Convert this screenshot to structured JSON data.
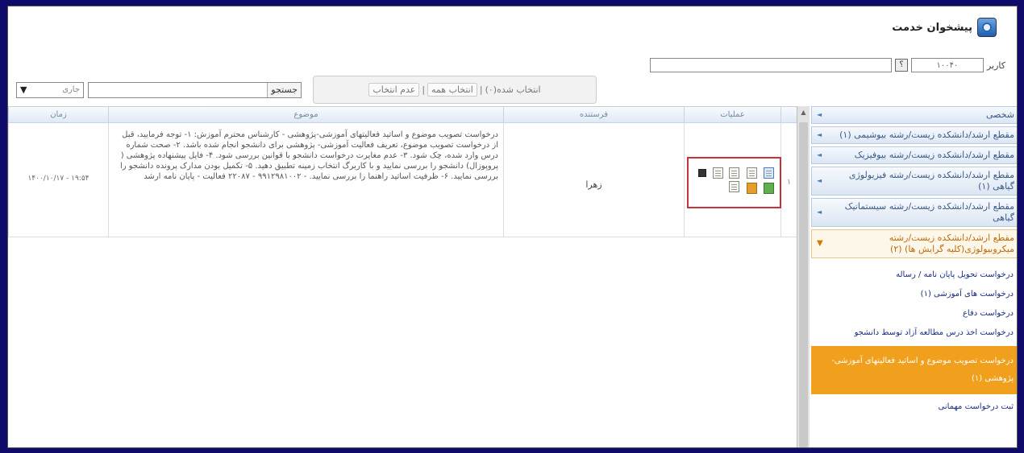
{
  "header": {
    "title": "پیشخوان خدمت",
    "logo_icon": "service-desk-logo-icon"
  },
  "user_bar": {
    "label": "کاربر",
    "code_value": "۱۰۰۴۰",
    "help_label": "؟",
    "name_value": ""
  },
  "toolbar": {
    "select_value": "جاری",
    "search_label": "جستجو",
    "search_value": "",
    "selected_count": "انتخاب شده(۰)",
    "select_all": "انتخاب همه",
    "deselect": "عدم انتخاب",
    "sep": "|"
  },
  "grid": {
    "columns": {
      "num": "",
      "ops": "عملیات",
      "sender": "فرستنده",
      "subject": "موضوع",
      "time": "زمان"
    },
    "rows": [
      {
        "num": "۱",
        "sender": "زهرا",
        "subject": "درخواست تصویب موضوع و اساتید فعالیتهای آموزشی-پژوهشی - کارشناس محترم آموزش: ۱- توجه فرمایید، قبل از درخواست تصویب موضوع، تعریف فعالیت آموزشی- پژوهشی برای دانشجو انجام شده باشد. ۲- صحت شماره درس وارد شده، چک شود. ۳- عدم مغایرت درخواست دانشجو با قوانین بررسی شود. ۴- فایل پیشنهاده پژوهشی ( پروپوزال) دانشجو را بررسی نمایید و با کاربرگ انتخاب زمینه تطبیق دهید. ۵- تکمیل بودن مدارک پرونده دانشجو را بررسی نمایید. ۶- ظرفیت اساتید راهنما را بررسی نمایید. - ۹۹۱۲۹۸۱۰۰۲ - ۲۲۰۸۷ فعالیت - پایان نامه ارشد",
        "time": "۱۴۰۰/۱۰/۱۷ - ۱۹:۵۴"
      }
    ]
  },
  "sidebar": {
    "items": [
      {
        "label": "شخصی",
        "caret": "◄"
      },
      {
        "label": "مقطع ارشد/دانشکده زیست/رشته بیوشیمی (۱)",
        "caret": "◄"
      },
      {
        "label": "مقطع ارشد/دانشکده زیست/رشته بیوفیزیک",
        "caret": "◄"
      },
      {
        "label": "مقطع ارشد/دانشکده زیست/رشته فیزیولوژی گیاهی (۱)",
        "caret": "◄"
      },
      {
        "label": "مقطع ارشد/دانشکده زیست/رشته سیستماتیک گیاهی",
        "caret": "◄"
      },
      {
        "label": "مقطع ارشد/دانشکده زیست/رشته میکروبیولوژی(کلیه گرایش ها) (۲)",
        "caret": "▼"
      }
    ],
    "sub_items": [
      "درخواست تحویل پایان نامه / رساله",
      "درخواست های آموزشی (۱)",
      "درخواست دفاع",
      "درخواست اخذ درس مطالعه آزاد توسط دانشجو",
      "درخواست تصویب موضوع و اساتید فعالیتهای آموزشی-پژوهشی (۱)",
      "ثبت درخواست مهمانی"
    ]
  },
  "colors": {
    "frame_border": "#0f0b6b",
    "highlight_box": "#c8323a",
    "active_item": "#f0a01c",
    "open_group": "#c06a09"
  }
}
